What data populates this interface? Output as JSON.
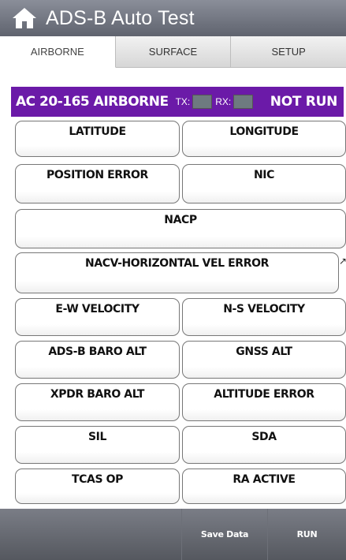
{
  "header": {
    "title": "ADS-B Auto Test",
    "home_icon": "home-icon"
  },
  "tabs": [
    {
      "label": "AIRBORNE",
      "active": true
    },
    {
      "label": "SURFACE",
      "active": false
    },
    {
      "label": "SETUP",
      "active": false
    }
  ],
  "status": {
    "standard": "AC 20-165 AIRBORNE",
    "tx_label": "TX:",
    "rx_label": "RX:",
    "result": "NOT RUN",
    "bar_color": "#6b1aa8",
    "led_color": "#6e7a80"
  },
  "results": [
    "LATITUDE",
    "LONGITUDE",
    "POSITION ERROR",
    "NIC",
    "NACP",
    "NACV-HORIZONTAL VEL ERROR",
    "E-W VELOCITY",
    "N-S VELOCITY",
    "ADS-B BARO ALT",
    "GNSS ALT",
    "XPDR BARO ALT",
    "ALTITUDE ERROR",
    "SIL",
    "SDA",
    "TCAS OP",
    "RA ACTIVE"
  ],
  "scroll_indicator": "↗",
  "footer": {
    "save_label": "Save Data",
    "run_label": "RUN"
  }
}
